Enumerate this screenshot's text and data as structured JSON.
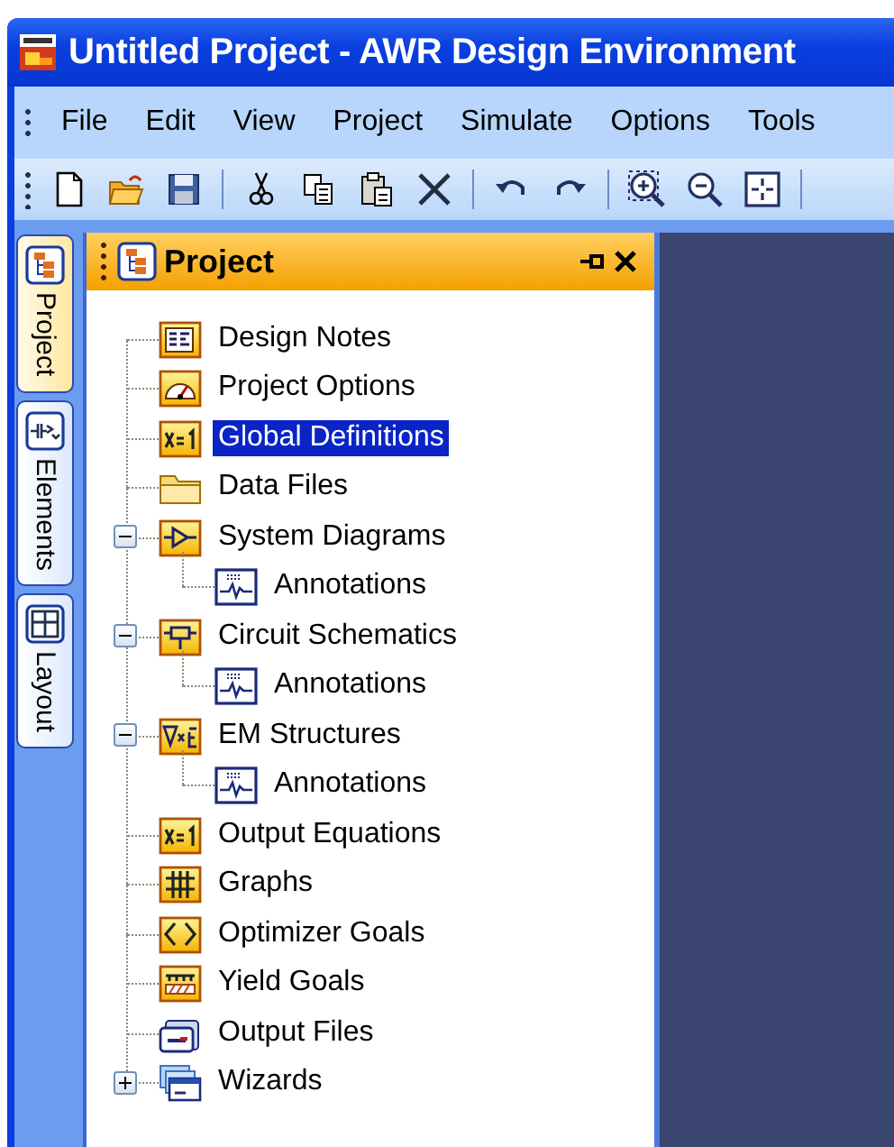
{
  "window": {
    "title": "Untitled Project - AWR Design Environment"
  },
  "menu": [
    {
      "label": "File"
    },
    {
      "label": "Edit"
    },
    {
      "label": "View"
    },
    {
      "label": "Project"
    },
    {
      "label": "Simulate"
    },
    {
      "label": "Options"
    },
    {
      "label": "Tools"
    }
  ],
  "toolbar": [
    {
      "kind": "new"
    },
    {
      "kind": "open"
    },
    {
      "kind": "save"
    },
    {
      "kind": "separator"
    },
    {
      "kind": "cut"
    },
    {
      "kind": "copy"
    },
    {
      "kind": "paste"
    },
    {
      "kind": "delete"
    },
    {
      "kind": "separator"
    },
    {
      "kind": "undo"
    },
    {
      "kind": "redo"
    },
    {
      "kind": "separator"
    },
    {
      "kind": "zoom-in"
    },
    {
      "kind": "zoom-out"
    },
    {
      "kind": "zoom-fit"
    },
    {
      "kind": "separator"
    }
  ],
  "side_tabs": [
    {
      "label": "Project",
      "kind": "project",
      "selected": true
    },
    {
      "label": "Elements",
      "kind": "elements",
      "selected": false
    },
    {
      "label": "Layout",
      "kind": "layout",
      "selected": false
    }
  ],
  "panel": {
    "title": "Project"
  },
  "tree": [
    {
      "label": "Design Notes",
      "kind": "notes",
      "selected": false
    },
    {
      "label": "Project Options",
      "kind": "options",
      "selected": false
    },
    {
      "label": "Global Definitions",
      "kind": "definitions",
      "selected": true
    },
    {
      "label": "Data Files",
      "kind": "folder",
      "selected": false
    },
    {
      "label": "System Diagrams",
      "kind": "system",
      "selected": false,
      "expanded": true,
      "children": [
        {
          "label": "Annotations",
          "kind": "annotation",
          "selected": false
        }
      ]
    },
    {
      "label": "Circuit Schematics",
      "kind": "circuit",
      "selected": false,
      "expanded": true,
      "children": [
        {
          "label": "Annotations",
          "kind": "annotation",
          "selected": false
        }
      ]
    },
    {
      "label": "EM Structures",
      "kind": "em",
      "selected": false,
      "expanded": true,
      "children": [
        {
          "label": "Annotations",
          "kind": "annotation",
          "selected": false
        }
      ]
    },
    {
      "label": "Output Equations",
      "kind": "definitions",
      "selected": false
    },
    {
      "label": "Graphs",
      "kind": "graphs",
      "selected": false
    },
    {
      "label": "Optimizer Goals",
      "kind": "goals",
      "selected": false
    },
    {
      "label": "Yield Goals",
      "kind": "yield",
      "selected": false
    },
    {
      "label": "Output Files",
      "kind": "output",
      "selected": false
    },
    {
      "label": "Wizards",
      "kind": "wizard",
      "selected": false,
      "expanded": false
    }
  ]
}
